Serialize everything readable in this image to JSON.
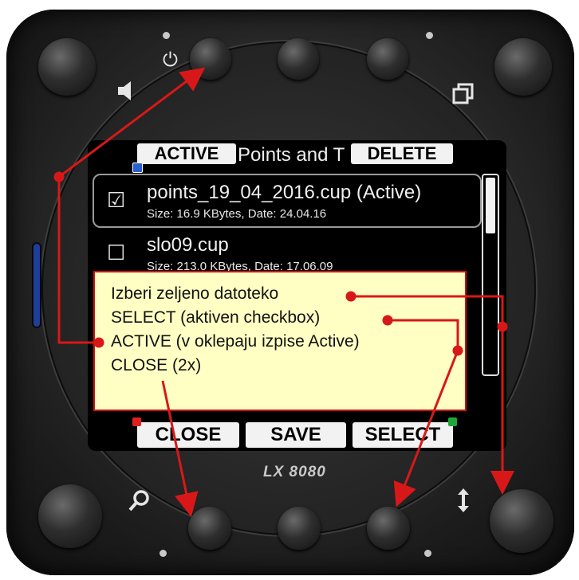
{
  "device": {
    "brand": "LX 8080"
  },
  "screen": {
    "title": "Points and T",
    "top_buttons": {
      "active": "ACTIVE",
      "delete": "DELETE"
    },
    "files": [
      {
        "name": "points_19_04_2016.cup (Active)",
        "info": "Size: 16.9 KBytes, Date: 24.04.16",
        "checked": "☑"
      },
      {
        "name": "slo09.cup",
        "info": "Size: 213.0 KBytes, Date: 17.06.09",
        "checked": "☐"
      }
    ],
    "bottom_buttons": {
      "close": "CLOSE",
      "save": "SAVE",
      "select": "SELECT"
    }
  },
  "annotation": {
    "lines": [
      "Izberi zeljeno datoteko",
      "SELECT (aktiven checkbox)",
      "ACTIVE (v oklepaju izpise Active)",
      "CLOSE (2x)"
    ]
  },
  "icons": {
    "power": "⏻",
    "speaker": "🔈",
    "copy": "⧉",
    "search": "🔍",
    "updown": "↕"
  },
  "colors": {
    "arrow": "#d81818",
    "note_bg": "#ffffc4",
    "led": "#1d3f9a"
  }
}
